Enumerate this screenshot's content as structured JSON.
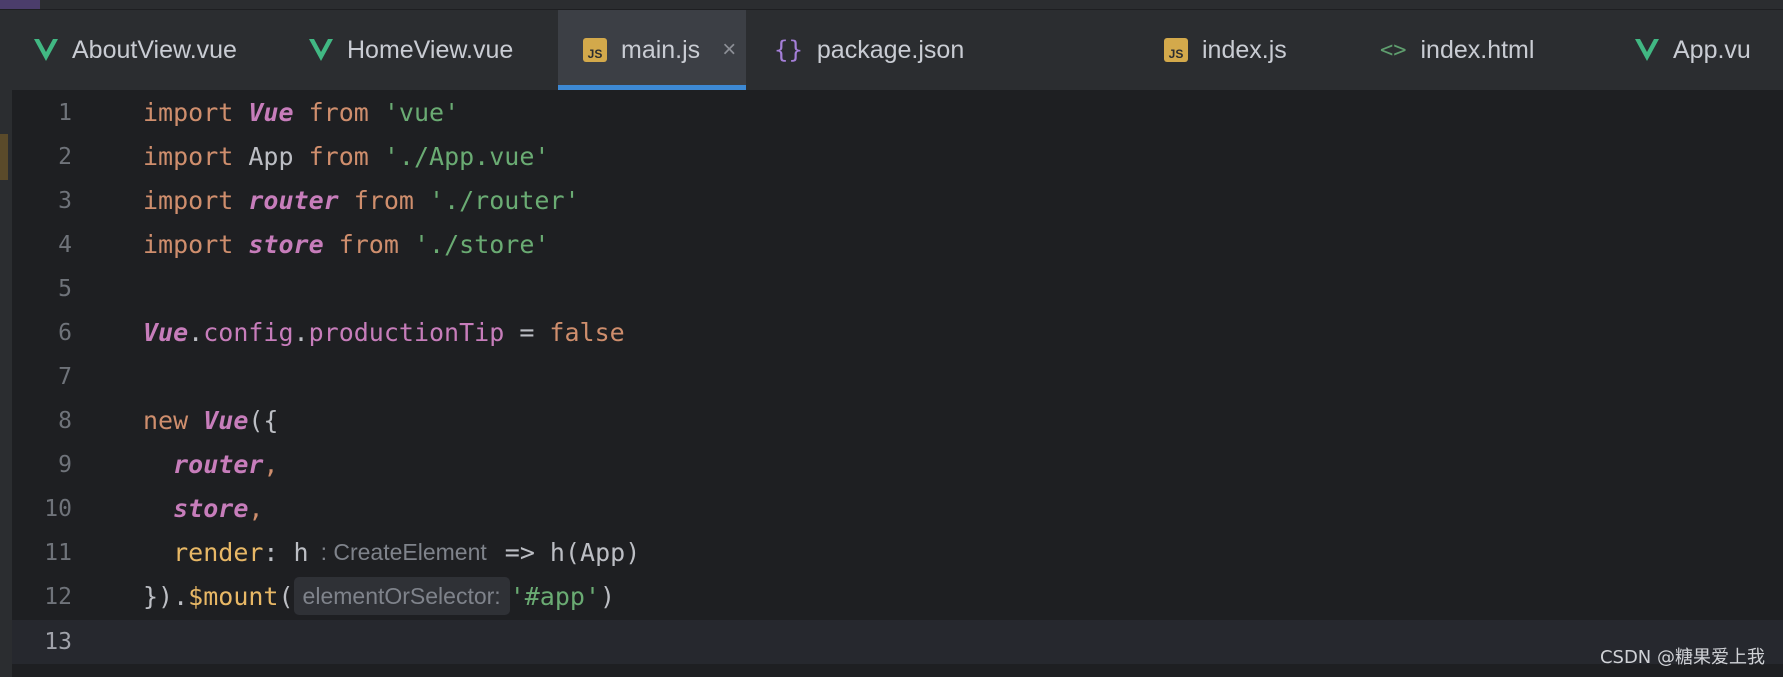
{
  "tabs": [
    {
      "label": "AboutView.vue",
      "icon": "vue-icon",
      "active": false
    },
    {
      "label": "HomeView.vue",
      "icon": "vue-icon",
      "active": false
    },
    {
      "label": "main.js",
      "icon": "js-icon",
      "active": true,
      "close": "×"
    },
    {
      "label": "package.json",
      "icon": "json-icon",
      "active": false
    },
    {
      "label": "index.js",
      "icon": "js-icon",
      "active": false
    },
    {
      "label": "index.html",
      "icon": "html-icon",
      "active": false
    },
    {
      "label": "App.vu",
      "icon": "vue-icon",
      "active": false
    }
  ],
  "icons": {
    "js": "JS",
    "json": "{}",
    "html": "<>"
  },
  "editor": {
    "line_numbers": [
      "1",
      "2",
      "3",
      "4",
      "5",
      "6",
      "7",
      "8",
      "9",
      "10",
      "11",
      "12",
      "13"
    ],
    "current_line": 13,
    "lines": {
      "l1": {
        "t1": "import",
        "t2": "Vue",
        "t3": "from",
        "t4": "'vue'"
      },
      "l2": {
        "t1": "import",
        "t2": "App",
        "t3": "from",
        "t4": "'./App.vue'"
      },
      "l3": {
        "t1": "import",
        "t2": "router",
        "t3": "from",
        "t4": "'./router'"
      },
      "l4": {
        "t1": "import",
        "t2": "store",
        "t3": "from",
        "t4": "'./store'"
      },
      "l6": {
        "t1": "Vue",
        "t2": ".",
        "t3": "config",
        "t4": ".",
        "t5": "productionTip",
        "t6": " = ",
        "t7": "false"
      },
      "l8": {
        "t1": "new",
        "t2": "Vue",
        "t3": "({"
      },
      "l9": {
        "t1": "router",
        "t2": ","
      },
      "l10": {
        "t1": "store",
        "t2": ","
      },
      "l11": {
        "t1": "render",
        "t2": ": h",
        "hint": ": CreateElement",
        "t3": "=> h(App)"
      },
      "l12": {
        "t1": "})",
        "t2": ".",
        "t3": "$mount",
        "t4": "(",
        "hint": "elementOrSelector:",
        "t5": "'#app'",
        "t6": ")"
      }
    }
  },
  "watermark": "CSDN @糖果爱上我",
  "colors": {
    "keyword": "#cf8e6d",
    "class": "#c77dbb",
    "string": "#6aab73",
    "function": "#e8b866",
    "accent": "#3d89d4"
  }
}
